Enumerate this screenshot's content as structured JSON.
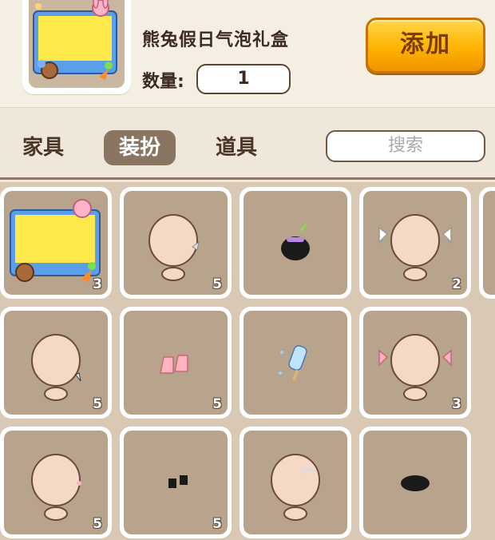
{
  "header": {
    "item_name": "熊兔假日气泡礼盒",
    "quantity_label": "数量:",
    "quantity_value": "1",
    "add_label": "添加"
  },
  "tabs": [
    {
      "label": "家具",
      "active": false
    },
    {
      "label": "装扮",
      "active": true
    },
    {
      "label": "道具",
      "active": false
    }
  ],
  "search": {
    "placeholder": "搜索"
  },
  "items": [
    {
      "icon": "gift-box-icon",
      "count": "3"
    },
    {
      "icon": "head-accessory-icon",
      "count": "5"
    },
    {
      "icon": "black-creature-icon",
      "count": ""
    },
    {
      "icon": "white-bow-head-icon",
      "count": "2"
    },
    {
      "icon": "fang-head-icon",
      "count": "5"
    },
    {
      "icon": "pink-socks-icon",
      "count": "5"
    },
    {
      "icon": "ice-pop-icon",
      "count": ""
    },
    {
      "icon": "pink-bow-head-icon",
      "count": "3"
    },
    {
      "icon": "ear-clip-head-icon",
      "count": "5"
    },
    {
      "icon": "black-shoes-icon",
      "count": "5"
    },
    {
      "icon": "hair-clip-head-icon",
      "count": ""
    },
    {
      "icon": "black-slippers-icon",
      "count": ""
    }
  ],
  "colors": {
    "accent": "#ffb300",
    "active_tab": "#8a7462",
    "slot_bg": "#b8a48d"
  }
}
